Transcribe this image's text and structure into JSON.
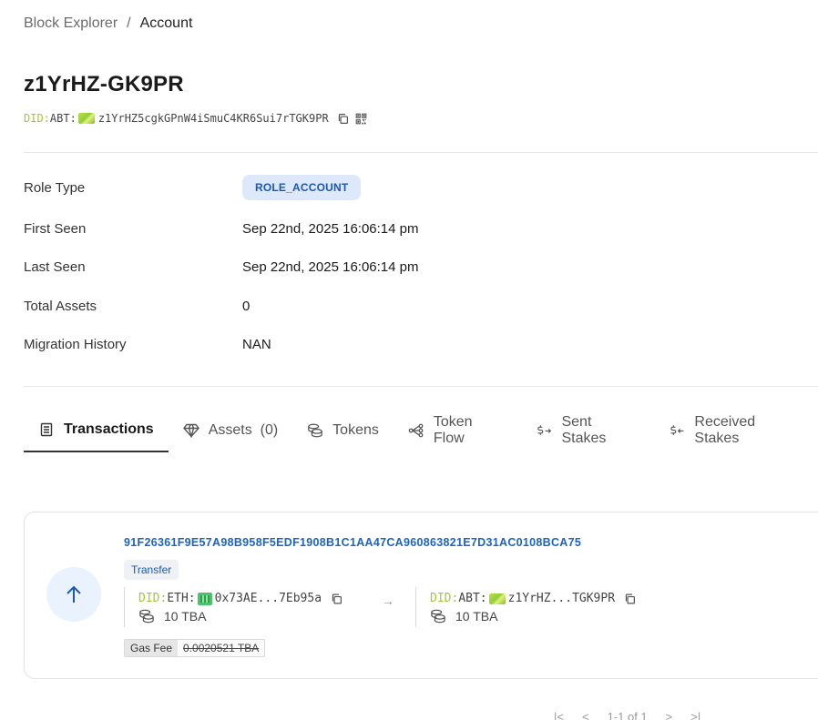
{
  "breadcrumb": {
    "root": "Block Explorer",
    "separator": "/",
    "current": "Account"
  },
  "account": {
    "title": "z1YrHZ-GK9PR",
    "did_prefix": "DID:",
    "did_chain": "ABT:",
    "did_value": "z1YrHZ5cgkGPnW4iSmuC4KR6Sui7rTGK9PR"
  },
  "info": {
    "role_type": {
      "label": "Role Type",
      "value": "ROLE_ACCOUNT"
    },
    "first_seen": {
      "label": "First Seen",
      "value": "Sep 22nd, 2025 16:06:14 pm"
    },
    "last_seen": {
      "label": "Last Seen",
      "value": "Sep 22nd, 2025 16:06:14 pm"
    },
    "total_assets": {
      "label": "Total Assets",
      "value": "0"
    },
    "migration_history": {
      "label": "Migration History",
      "value": "NAN"
    }
  },
  "tabs": [
    {
      "label": "Transactions",
      "icon": "list-icon",
      "active": true
    },
    {
      "label": "Assets  (0)",
      "icon": "diamond-icon",
      "active": false
    },
    {
      "label": "Tokens",
      "icon": "coins-icon",
      "active": false
    },
    {
      "label": "Token Flow",
      "icon": "flow-icon",
      "active": false
    },
    {
      "label": "Sent Stakes",
      "icon": "dollar-out-icon",
      "active": false
    },
    {
      "label": "Received Stakes",
      "icon": "dollar-in-icon",
      "active": false
    }
  ],
  "transaction": {
    "hash": "91F26361F9E57A98B958F5EDF1908B1C1AA47CA960863821E7D31AC0108BCA75",
    "type": "Transfer",
    "direction_icon": "arrow-up-icon",
    "from": {
      "did_prefix": "DID:",
      "did_chain": "ETH:",
      "did_short": "0x73AE...7Eb95a",
      "amount": "10 TBA"
    },
    "to": {
      "did_prefix": "DID:",
      "did_chain": "ABT:",
      "did_short": "z1YrHZ...TGK9PR",
      "amount": "10 TBA"
    },
    "arrow": "→",
    "gas_label": "Gas Fee",
    "gas_value": "0.0020521 TBA"
  },
  "pagination": {
    "first": "|<",
    "prev": "<",
    "range": "1-1 of 1",
    "next": ">",
    "last": ">|"
  },
  "colors": {
    "accent_blue": "#1b63c6",
    "did_green": "#a4c934",
    "badge_bg": "#dde9fb"
  }
}
